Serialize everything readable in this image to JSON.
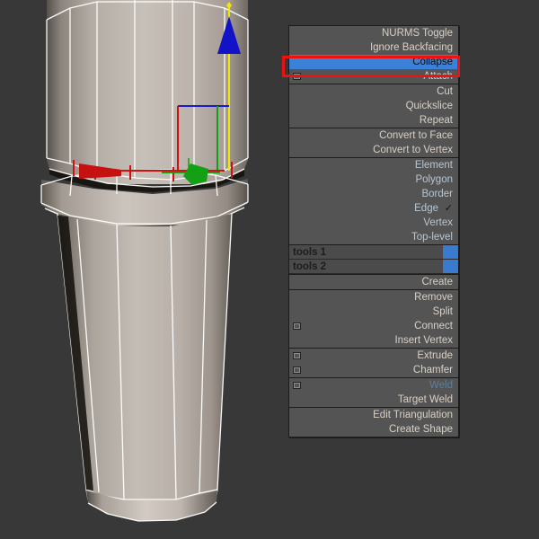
{
  "app": {
    "viewport_background": "#383838",
    "menu_background": "#545454",
    "accent_selected": "#3c81d8",
    "annotation_color": "#ee1111",
    "swatch_color": "#3a7ad0",
    "text_color": "#d9d1c7",
    "disabled_text_color": "#5f7e9c"
  },
  "viewport": {
    "object_name": "vase-wireframe-model",
    "gizmo": {
      "name": "transform-gizmo",
      "axis_x_color": "#cc1111",
      "axis_y_color": "#11a011",
      "axis_z_color": "#1111cc",
      "center_handle_color": "#14a014",
      "guide_color": "#f2e800"
    }
  },
  "quad_menu": {
    "name": "quad-menu",
    "groups": [
      {
        "name": "group-edit",
        "items": [
          {
            "label": "NURMS Toggle",
            "state": "normal",
            "option_box": false,
            "checked": false
          },
          {
            "label": "Ignore Backfacing",
            "state": "normal",
            "option_box": false,
            "checked": false
          },
          {
            "label": "Collapse",
            "state": "selected",
            "option_box": false,
            "checked": false
          },
          {
            "label": "Attach",
            "state": "normal",
            "option_box": true,
            "checked": false
          }
        ]
      },
      {
        "name": "group-cut",
        "items": [
          {
            "label": "Cut",
            "state": "normal",
            "option_box": false,
            "checked": false
          },
          {
            "label": "Quickslice",
            "state": "normal",
            "option_box": false,
            "checked": false
          },
          {
            "label": "Repeat",
            "state": "normal",
            "option_box": false,
            "checked": false
          }
        ]
      },
      {
        "name": "group-convert",
        "items": [
          {
            "label": "Convert to Face",
            "state": "normal",
            "option_box": false,
            "checked": false
          },
          {
            "label": "Convert to Vertex",
            "state": "normal",
            "option_box": false,
            "checked": false
          }
        ]
      },
      {
        "name": "group-subobject",
        "items": [
          {
            "label": "Element",
            "state": "sub",
            "option_box": false,
            "checked": false
          },
          {
            "label": "Polygon",
            "state": "sub",
            "option_box": false,
            "checked": false
          },
          {
            "label": "Border",
            "state": "sub",
            "option_box": false,
            "checked": false
          },
          {
            "label": "Edge",
            "state": "sub",
            "option_box": false,
            "checked": true
          },
          {
            "label": "Vertex",
            "state": "sub",
            "option_box": false,
            "checked": false
          },
          {
            "label": "Top-level",
            "state": "sub",
            "option_box": false,
            "checked": false
          }
        ]
      }
    ],
    "tool_rows": [
      {
        "label": "tools 1",
        "swatch": "#3a7ad0"
      },
      {
        "label": "tools 2",
        "swatch": "#3a7ad0"
      }
    ],
    "groups_lower": [
      {
        "name": "group-create",
        "items": [
          {
            "label": "Create",
            "state": "normal",
            "option_box": false,
            "checked": false
          }
        ]
      },
      {
        "name": "group-edge-ops",
        "items": [
          {
            "label": "Remove",
            "state": "normal",
            "option_box": false,
            "checked": false
          },
          {
            "label": "Split",
            "state": "normal",
            "option_box": false,
            "checked": false
          },
          {
            "label": "Connect",
            "state": "normal",
            "option_box": true,
            "checked": false
          },
          {
            "label": "Insert Vertex",
            "state": "normal",
            "option_box": false,
            "checked": false
          }
        ]
      },
      {
        "name": "group-extrude",
        "items": [
          {
            "label": "Extrude",
            "state": "normal",
            "option_box": true,
            "checked": false
          },
          {
            "label": "Chamfer",
            "state": "normal",
            "option_box": true,
            "checked": false
          }
        ]
      },
      {
        "name": "group-weld",
        "items": [
          {
            "label": "Weld",
            "state": "disabled",
            "option_box": true,
            "checked": false
          },
          {
            "label": "Target Weld",
            "state": "normal",
            "option_box": false,
            "checked": false
          }
        ]
      },
      {
        "name": "group-shape",
        "items": [
          {
            "label": "Edit Triangulation",
            "state": "normal",
            "option_box": false,
            "checked": false
          },
          {
            "label": "Create Shape",
            "state": "normal",
            "option_box": false,
            "checked": false
          }
        ]
      }
    ]
  },
  "annotation": {
    "name": "collapse-highlight-box",
    "targets_label": "Collapse"
  }
}
